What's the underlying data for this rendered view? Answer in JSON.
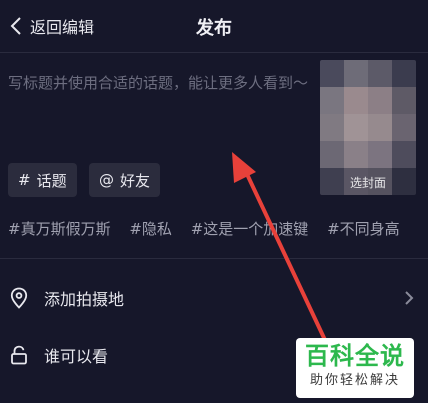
{
  "header": {
    "back_label": "返回编辑",
    "title": "发布"
  },
  "caption": {
    "placeholder": "写标题并使用合适的话题，能让更多人看到～"
  },
  "cover": {
    "label": "选封面"
  },
  "chips": [
    {
      "symbol": "#",
      "label": "话题"
    },
    {
      "symbol": "@",
      "label": "好友"
    }
  ],
  "suggested_tags": [
    "#真万斯假万斯",
    "#隐私",
    "#这是一个加速键",
    "#不同身高"
  ],
  "rows": [
    {
      "label": "添加拍摄地",
      "icon": "location-pin-icon"
    },
    {
      "label": "谁可以看",
      "icon": "lock-icon"
    }
  ],
  "watermark": {
    "main": "百科全说",
    "sub": "助你轻松解决"
  },
  "colors": {
    "background": "#16172a",
    "chip": "#2b2c3d",
    "arrow": "#e8413a",
    "watermark_green": "#2db84d"
  }
}
